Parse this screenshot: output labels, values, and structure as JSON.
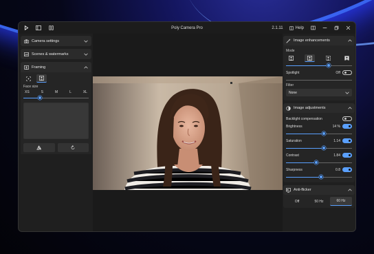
{
  "window": {
    "title": "Poly Camera Pro",
    "version": "2.1.11",
    "help_label": "Help"
  },
  "left": {
    "camera_settings": "Camera settings",
    "scenes": "Scenes & watermarks",
    "framing": "Framing",
    "face_size_label": "Face size",
    "face_sizes": [
      "XS",
      "S",
      "M",
      "L",
      "XL"
    ],
    "face_size_value": 0.25
  },
  "right": {
    "image_enhancements": {
      "title": "Image enhancements",
      "mode_label": "Mode",
      "mode_level": 0.65,
      "spotlight_label": "Spotlight",
      "spotlight_state": "Off",
      "filter_label": "Filter",
      "filter_value": "None"
    },
    "image_adjustments": {
      "title": "Image adjustments",
      "backlight_label": "Backlight compensation",
      "brightness_label": "Brightness",
      "brightness_value": "14 %",
      "brightness_level": 0.57,
      "saturation_label": "Saturation",
      "saturation_value": "1.14",
      "saturation_level": 0.57,
      "contrast_label": "Contrast",
      "contrast_value": "1.84",
      "contrast_level": 0.46,
      "sharpness_label": "Sharpness",
      "sharpness_value": "0.8",
      "sharpness_level": 0.53
    },
    "anti_flicker": {
      "title": "Anti-flicker",
      "options": [
        "Off",
        "50 Hz",
        "60 Hz"
      ],
      "selected": "60 Hz"
    }
  },
  "colors": {
    "accent": "#5aa0ff",
    "panel": "#252525",
    "header": "#2b2b2b"
  }
}
